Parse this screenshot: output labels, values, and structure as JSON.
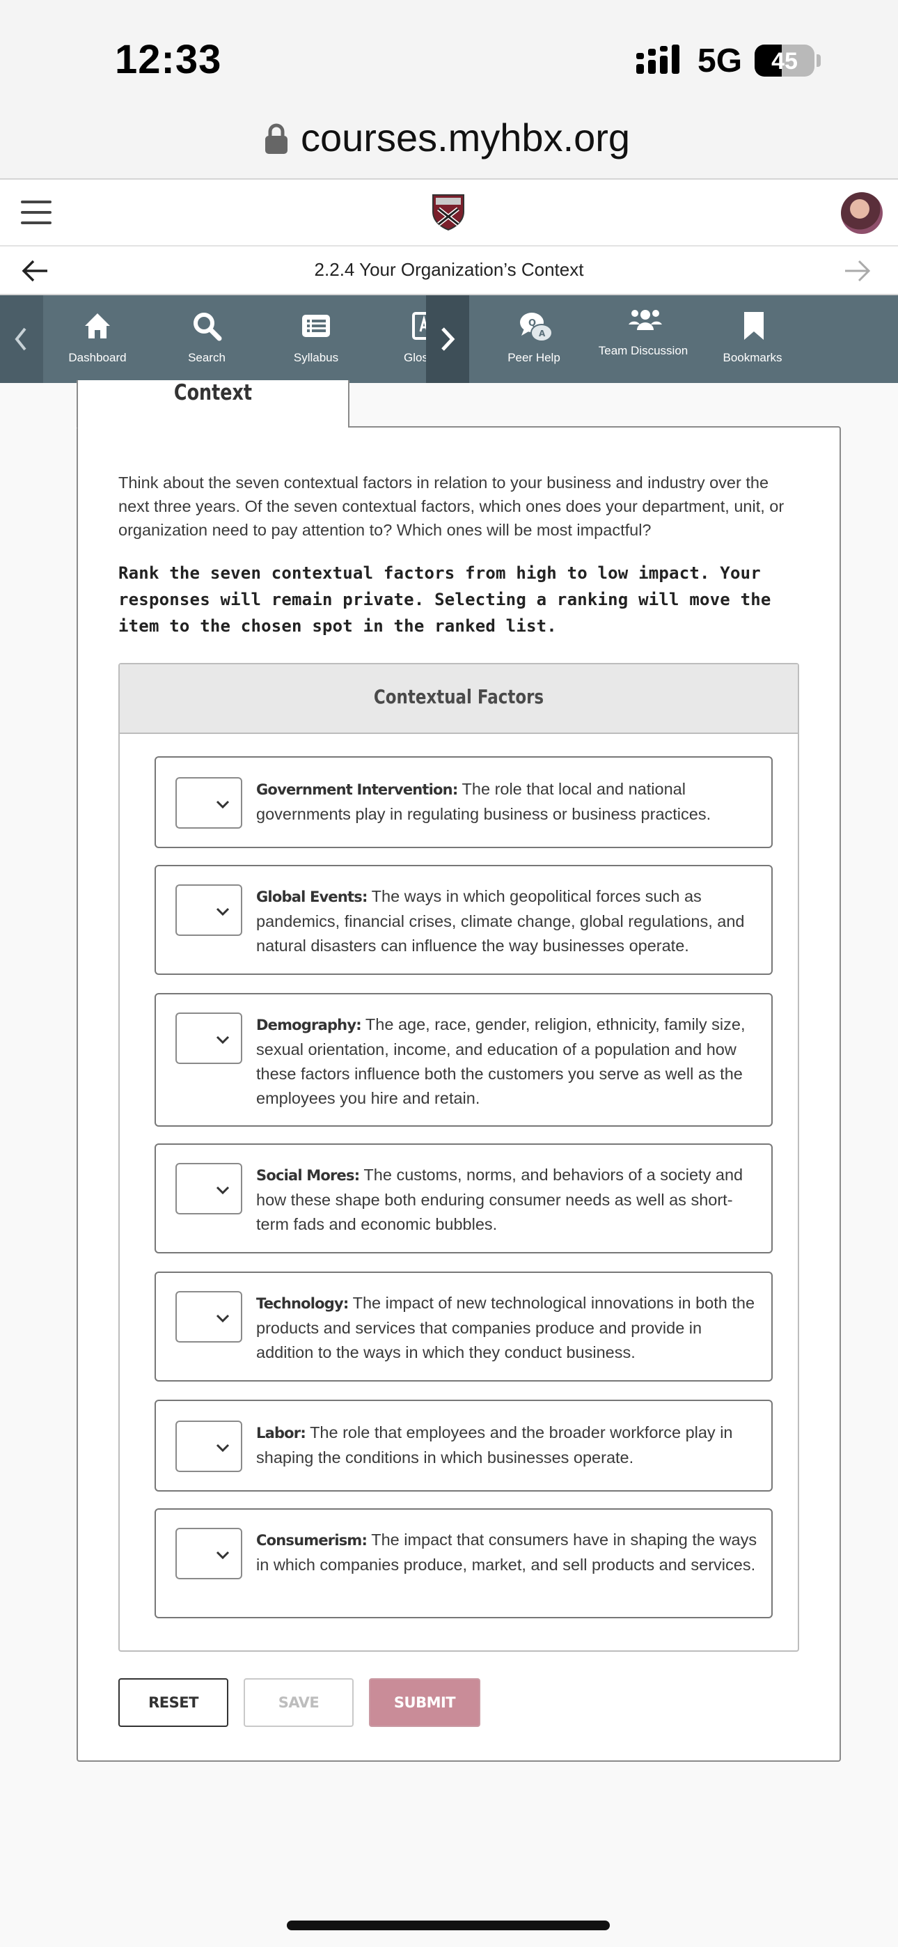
{
  "status_bar": {
    "time": "12:33",
    "network": "5G",
    "battery": "45",
    "battery_level_percent": 45
  },
  "browser": {
    "url": "courses.myhbx.org"
  },
  "lesson": {
    "title": "2.2.4 Your Organization’s Context"
  },
  "toolbar": {
    "items": [
      {
        "label": "Dashboard",
        "icon": "home-icon"
      },
      {
        "label": "Search",
        "icon": "search-icon"
      },
      {
        "label": "Syllabus",
        "icon": "syllabus-icon"
      },
      {
        "label": "Glos",
        "icon": "glossary-icon"
      },
      {
        "label": "Peer Help",
        "icon": "peer-help-icon"
      },
      {
        "label": "Team Discussion",
        "icon": "team-discussion-icon"
      },
      {
        "label": "Bookmarks",
        "icon": "bookmark-icon"
      }
    ]
  },
  "card": {
    "tab_label": "Context",
    "intro": "Think about the seven contextual factors in relation to your business and industry over the next three years. Of the seven contextual factors, which ones does your department, unit, or organization need to pay attention to? Which ones will be most impactful?",
    "instruction": "Rank the seven contextual factors from high to low impact. Your responses will remain private. Selecting a ranking will move the item to the chosen spot in the ranked list."
  },
  "factors": {
    "header": "Contextual Factors",
    "items": [
      {
        "name": "Government Intervention:",
        "desc": "The role that local and national governments play in regulating business or business practices."
      },
      {
        "name": "Global Events:",
        "desc": "The ways in which geopolitical forces such as pandemics, financial crises, climate change, global regulations, and natural disasters can influence the way businesses operate."
      },
      {
        "name": "Demography:",
        "desc": "The age, race, gender, religion, ethnicity, family size, sexual orientation, income, and education of a population and how these factors influence both the customers you serve as well as the employees you hire and retain."
      },
      {
        "name": "Social Mores:",
        "desc": "The customs, norms, and behaviors of a society and how these shape both enduring consumer needs as well as short-term fads and economic bubbles."
      },
      {
        "name": "Technology:",
        "desc": "The impact of new technological innovations in both the products and services that companies produce and provide in addition to the ways in which they conduct business."
      },
      {
        "name": "Labor:",
        "desc": "The role that employees and the broader workforce play in shaping the conditions in which businesses operate."
      },
      {
        "name": "Consumerism:",
        "desc": "The impact that consumers have in shaping the ways in which companies produce, market, and sell products and services."
      }
    ]
  },
  "buttons": {
    "reset": "RESET",
    "save": "SAVE",
    "submit": "SUBMIT"
  },
  "colors": {
    "toolbar": "#5a6f79",
    "submit": "#c98c98"
  }
}
